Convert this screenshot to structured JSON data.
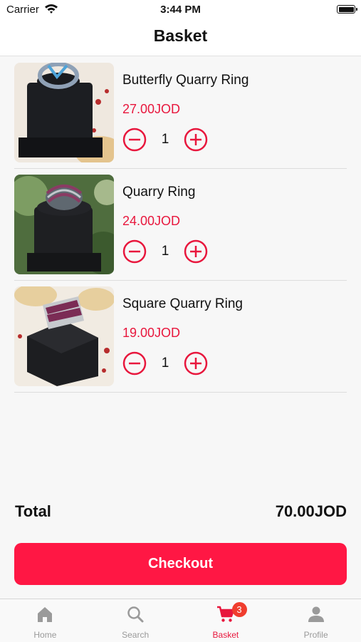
{
  "status_bar": {
    "carrier": "Carrier",
    "time": "3:44 PM"
  },
  "header": {
    "title": "Basket"
  },
  "items": [
    {
      "name": "Butterfly Quarry Ring",
      "price": "27.00JOD",
      "quantity": "1"
    },
    {
      "name": "Quarry Ring",
      "price": "24.00JOD",
      "quantity": "1"
    },
    {
      "name": "Square Quarry Ring",
      "price": "19.00JOD",
      "quantity": "1"
    }
  ],
  "summary": {
    "total_label": "Total",
    "total_amount": "70.00JOD"
  },
  "checkout_label": "Checkout",
  "tabs": [
    {
      "label": "Home",
      "icon": "home-icon"
    },
    {
      "label": "Search",
      "icon": "search-icon"
    },
    {
      "label": "Basket",
      "icon": "cart-icon",
      "badge": "3",
      "active": true
    },
    {
      "label": "Profile",
      "icon": "person-icon"
    }
  ],
  "colors": {
    "accent": "#ff1744",
    "price_text": "#e8173d",
    "badge": "#f03d2e",
    "inactive_tab": "#9a9a9a"
  }
}
